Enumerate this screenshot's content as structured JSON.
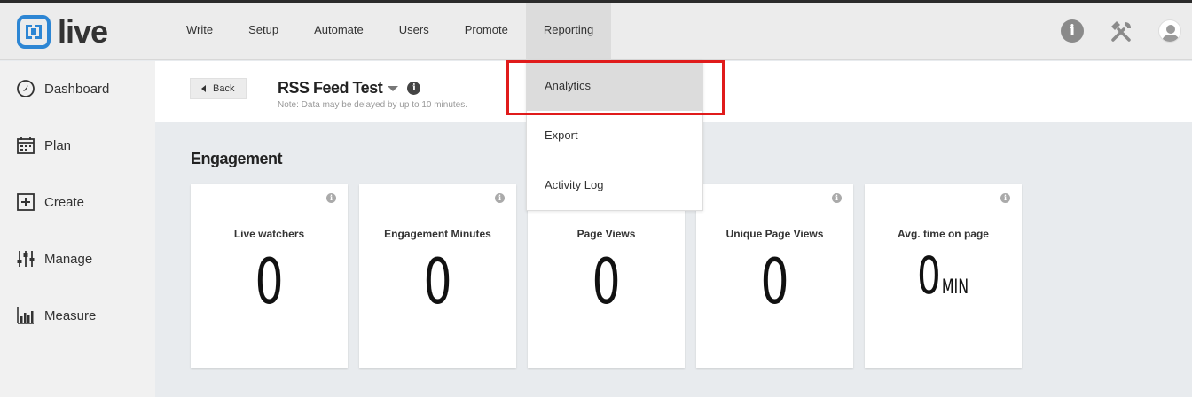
{
  "app": {
    "logo_text": "live",
    "brand_color": "#2d86d4"
  },
  "nav": {
    "items": [
      {
        "label": "Write"
      },
      {
        "label": "Setup"
      },
      {
        "label": "Automate"
      },
      {
        "label": "Users"
      },
      {
        "label": "Promote"
      },
      {
        "label": "Reporting",
        "active": true
      }
    ]
  },
  "top_icons": {
    "info": "i"
  },
  "sidebar": {
    "items": [
      {
        "label": "Dashboard",
        "icon": "dashboard-icon"
      },
      {
        "label": "Plan",
        "icon": "calendar-icon"
      },
      {
        "label": "Create",
        "icon": "plus-box-icon"
      },
      {
        "label": "Manage",
        "icon": "sliders-icon"
      },
      {
        "label": "Measure",
        "icon": "bar-chart-icon"
      }
    ]
  },
  "header": {
    "back_label": "Back",
    "title": "RSS Feed Test",
    "info": "i",
    "note": "Note: Data may be delayed by up to 10 minutes."
  },
  "section": {
    "title": "Engagement"
  },
  "cards": [
    {
      "label": "Live watchers",
      "value": "0",
      "info": "i"
    },
    {
      "label": "Engagement Minutes",
      "value": "0",
      "info": "i"
    },
    {
      "label": "Page Views",
      "value": "0",
      "info": "i"
    },
    {
      "label": "Unique Page Views",
      "value": "0",
      "info": "i"
    },
    {
      "label": "Avg. time on page",
      "value": "0",
      "unit": "MIN",
      "info": "i"
    }
  ],
  "dropdown": {
    "items": [
      {
        "label": "Analytics"
      },
      {
        "label": "Export"
      },
      {
        "label": "Activity Log"
      }
    ]
  },
  "colors": {
    "highlight": "#e01b1b"
  }
}
